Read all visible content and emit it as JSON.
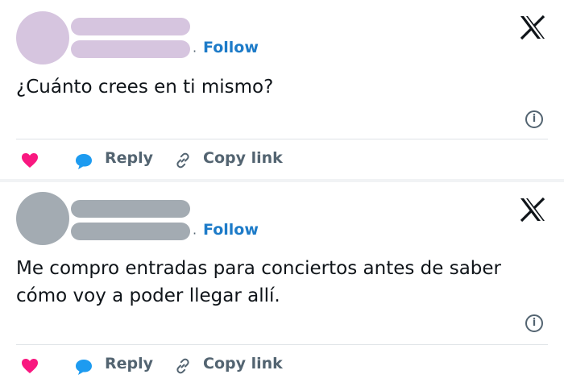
{
  "colors": {
    "follow": "#1d7bc8",
    "heart": "#f91880",
    "reply_icon": "#1d9bf0",
    "muted": "#536471",
    "avatar_1": "#d6c5df",
    "avatar_2": "#a3abb2"
  },
  "tweets": [
    {
      "follow_label": "Follow",
      "text_lines": [
        "¿Cuánto crees en ti mismo?"
      ],
      "info_glyph": "i",
      "reply_label": "Reply",
      "copy_label": "Copy link",
      "icons": [
        "x-logo-icon",
        "info-icon",
        "heart-icon",
        "reply-icon",
        "link-icon"
      ]
    },
    {
      "follow_label": "Follow",
      "text_lines": [
        "Me compro entradas para conciertos antes de saber",
        "cómo voy a poder llegar allí."
      ],
      "info_glyph": "i",
      "reply_label": "Reply",
      "copy_label": "Copy link",
      "icons": [
        "x-logo-icon",
        "info-icon",
        "heart-icon",
        "reply-icon",
        "link-icon"
      ]
    }
  ]
}
